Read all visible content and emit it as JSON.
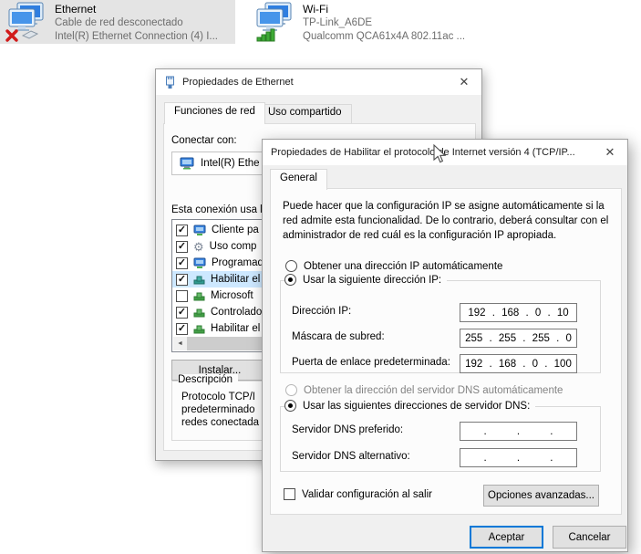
{
  "icons": {
    "close": "✕",
    "scroll_left": "◄",
    "gear": "⚙"
  },
  "colors": {
    "accent": "#0078d7",
    "selection": "#cde8ff",
    "disabled_text": "#838383"
  },
  "adapters": {
    "ethernet": {
      "name": "Ethernet",
      "status": "Cable de red desconectado",
      "device": "Intel(R) Ethernet Connection (4) I..."
    },
    "wifi": {
      "name": "Wi-Fi",
      "status": "TP-Link_A6DE",
      "device": "Qualcomm QCA61x4A 802.11ac ..."
    }
  },
  "ethernet_dialog": {
    "title": "Propiedades de Ethernet",
    "tabs": [
      {
        "label": "Funciones de red"
      },
      {
        "label": "Uso compartido"
      }
    ],
    "connect_label": "Conectar con:",
    "adapter_name": "Intel(R) Ethe",
    "uses_label": "Esta conexión usa l",
    "items": [
      {
        "label": "Cliente pa",
        "mark": "✓"
      },
      {
        "label": "Uso comp",
        "mark": "✓"
      },
      {
        "label": "Programad",
        "mark": "✓"
      },
      {
        "label": "Habilitar el",
        "mark": "✓"
      },
      {
        "label": "Microsoft",
        "mark": ""
      },
      {
        "label": "Controlado",
        "mark": "✓"
      },
      {
        "label": "Habilitar el",
        "mark": "✓"
      }
    ],
    "install_button": "Instalar...",
    "description_title": "Descripción",
    "description_lines": [
      "Protocolo TCP/I",
      "predeterminado",
      "redes conectada"
    ]
  },
  "tcpip_dialog": {
    "title": "Propiedades de Habilitar el protocolo de Internet versión 4 (TCP/IP...",
    "tab": "General",
    "intro_lines": [
      "Puede hacer que la configuración IP se asigne automáticamente si la",
      "red admite esta funcionalidad. De lo contrario, deberá consultar con el",
      "administrador de red cuál es la configuración IP apropiada."
    ],
    "radio_auto_ip": "Obtener una dirección IP automáticamente",
    "radio_manual_ip": "Usar la siguiente dirección IP:",
    "ip_fields": [
      {
        "label": "Dirección IP:",
        "value": "192 . 168 . 0 . 10"
      },
      {
        "label": "Máscara de subred:",
        "value": "255 . 255 . 255 . 0"
      },
      {
        "label": "Puerta de enlace predeterminada:",
        "value": "192 . 168 . 0 . 100"
      }
    ],
    "radio_auto_dns": "Obtener la dirección del servidor DNS automáticamente",
    "radio_manual_dns": "Usar las siguientes direcciones de servidor DNS:",
    "dns_fields": [
      {
        "label": "Servidor DNS preferido:",
        "value": ". . ."
      },
      {
        "label": "Servidor DNS alternativo:",
        "value": ". . ."
      }
    ],
    "validate_checkbox": "Validar configuración al salir",
    "advanced_button": "Opciones avanzadas...",
    "ok_button": "Aceptar",
    "cancel_button": "Cancelar"
  }
}
